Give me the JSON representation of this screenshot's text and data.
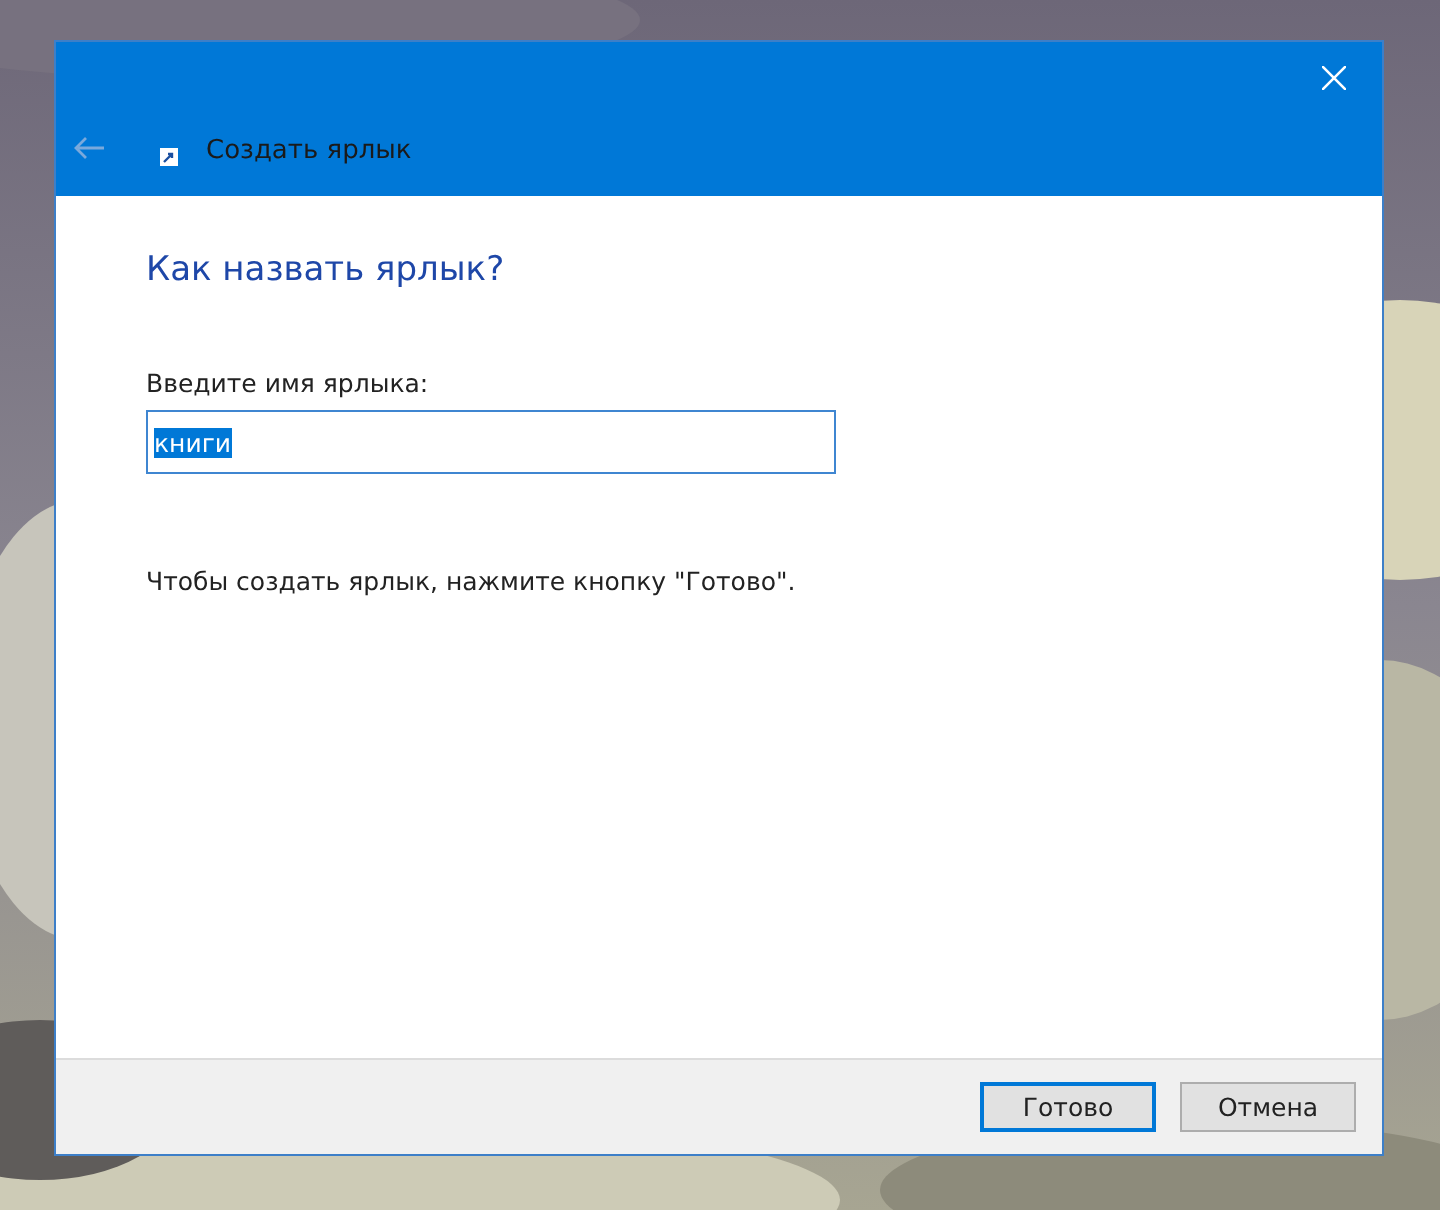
{
  "window": {
    "title": "Создать ярлык",
    "back_disabled": true
  },
  "heading": "Как назвать ярлык?",
  "field": {
    "label": "Введите имя ярлыка:",
    "value": "книги",
    "selected": true
  },
  "hint": "Чтобы создать ярлык, нажмите кнопку \"Готово\".",
  "buttons": [
    {
      "label": "Готово",
      "default": true
    },
    {
      "label": "Отмена",
      "default": false
    }
  ]
}
